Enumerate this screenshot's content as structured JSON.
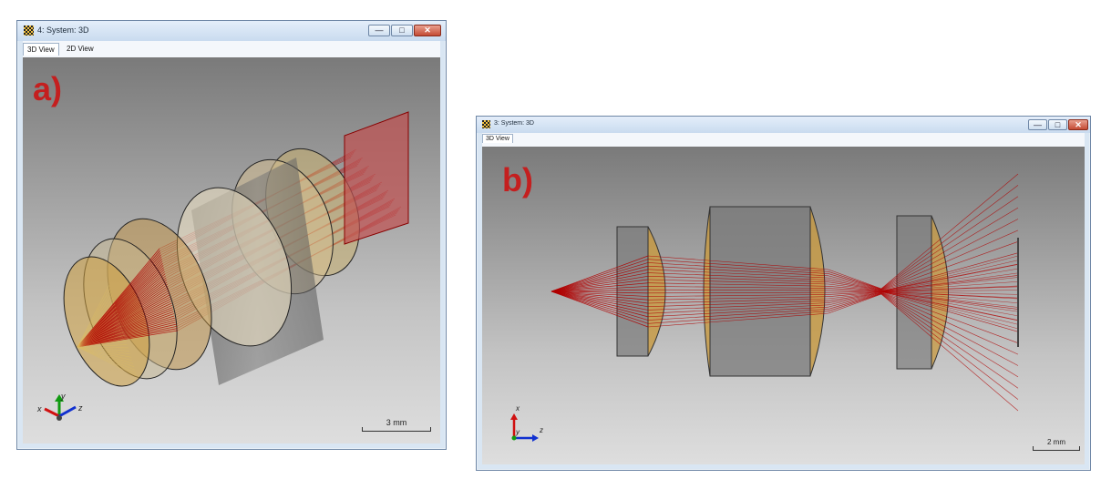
{
  "window_a": {
    "title": "4: System: 3D",
    "tabs": [
      "3D View",
      "2D View"
    ],
    "panel_label": "a)",
    "scale_label": "3 mm",
    "axis_labels": {
      "x": "x",
      "y": "y",
      "z": "z"
    }
  },
  "window_b": {
    "title": "3: System: 3D",
    "tabs": [
      "3D View"
    ],
    "panel_label": "b)",
    "scale_label": "2 mm",
    "axis_labels": {
      "x": "x",
      "y": "y",
      "z": "z"
    }
  },
  "controls": {
    "minimize": "—",
    "maximize": "□",
    "close": "✕"
  },
  "colors": {
    "ray": "#b00000",
    "lens": "#c8a040",
    "label": "#c41f1f"
  }
}
